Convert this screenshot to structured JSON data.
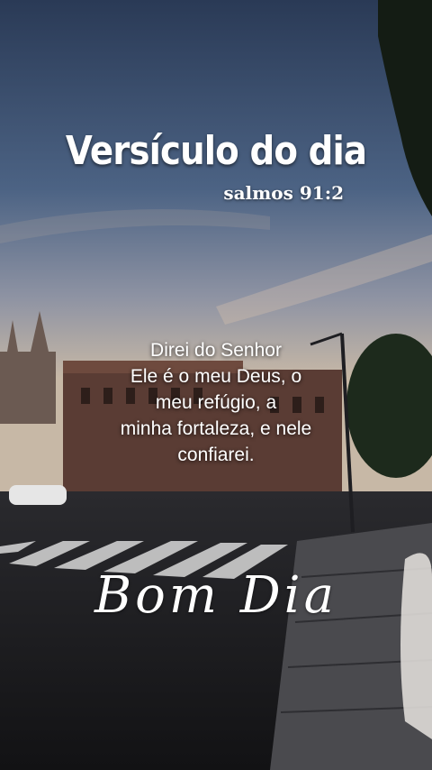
{
  "title": "Versículo do dia",
  "reference": "salmos 91:2",
  "verse_lines": [
    "Direi do Senhor",
    "Ele é o meu Deus, o",
    "meu refúgio, a",
    "minha fortaleza, e nele",
    "confiarei."
  ],
  "greeting": "Bom Dia",
  "colors": {
    "text": "#ffffff",
    "sky_top": "#2c3f5c",
    "sky_bottom": "#c9b8a4",
    "road": "#1c1c1f"
  }
}
